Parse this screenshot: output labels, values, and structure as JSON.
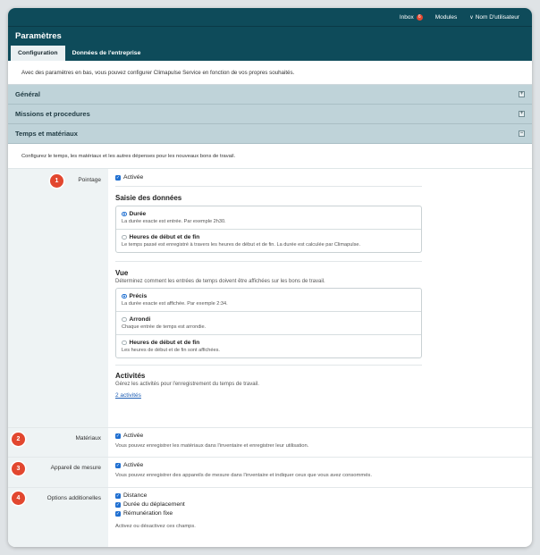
{
  "topbar": {
    "inbox": "Inbox",
    "inbox_count": "6",
    "modules": "Modules",
    "user": "Nom D'utilisateur"
  },
  "title": "Paramètres",
  "tabs": [
    {
      "label": "Configuration"
    },
    {
      "label": "Données de l'entreprise"
    }
  ],
  "intro": "Avec des paramètres en bas, vous pouvez configurer Climapulse Service en fonction de vos propres souhaités.",
  "sections": {
    "general": "Général",
    "missions": "Missions et procedures",
    "time": "Temps et matériaux"
  },
  "time_desc": "Configurez le temps, les matériaux et les autres dépenses pour les nouveaux bons de travail.",
  "pointage": {
    "step": "1",
    "label": "Pointage",
    "check": "Activée",
    "saisie": {
      "title": "Saisie des données",
      "options": [
        {
          "title": "Durée",
          "desc": "La durée exacte est entrée. Par exemple 2h30."
        },
        {
          "title": "Heures de début et de fin",
          "desc": "Le temps passé est enregistré à travers les heures de début et de fin. La durée est calculée par Climapulse."
        }
      ]
    },
    "vue": {
      "title": "Vue",
      "desc": "Déterminez comment les entrées de temps doivent être affichées sur les bons de travail.",
      "options": [
        {
          "title": "Précis",
          "desc": "La durée exacte est affichée. Par exemple 2:34."
        },
        {
          "title": "Arrondi",
          "desc": "Chaque entrée de temps est arrondie."
        },
        {
          "title": "Heures de début et de fin",
          "desc": "Les heures de début et de fin sont affichées."
        }
      ]
    },
    "activites": {
      "title": "Activités",
      "desc": "Gérez les activités pour l'enregistrement du temps de travail.",
      "link": "2 activités"
    }
  },
  "materiaux": {
    "step": "2",
    "label": "Matériaux",
    "check": "Activée",
    "desc": "Vous pouvez enregistrer les matériaux dans l'inventaire et enregistrer leur utilisation."
  },
  "appareil": {
    "step": "3",
    "label": "Appareil de mesure",
    "check": "Activée",
    "desc": "Vous pouvez enregistrer des appareils de mesure dans l'inventaire et indiquer ceux que vous avez consommés."
  },
  "options": {
    "step": "4",
    "label": "Options additionelles",
    "checks": [
      "Distance",
      "Durée du déplacement",
      "Rémunération fixe"
    ],
    "desc": "Activez ou désactivez ces champs."
  },
  "colors": {
    "header": "#0e4b5a",
    "section": "#bfd3d9",
    "step": "#e2472f",
    "accent": "#1f6fd1"
  }
}
